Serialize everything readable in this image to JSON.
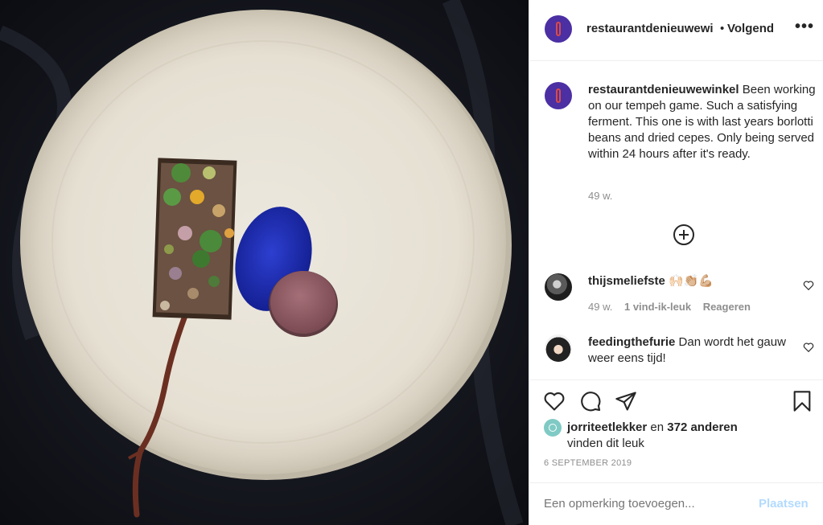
{
  "post": {
    "account": "restaurantdenieuwewi",
    "separator": "•",
    "follow_label": "Volgend",
    "more_icon": "more-dots-icon"
  },
  "caption": {
    "username": "restaurantdenieuwewinkel",
    "text": "Been working on our tempeh game. Such a satisfying ferment. This one is with last years borlotti beans and dried cepes. Only being served within 24 hours after it's ready.",
    "time": "49 w."
  },
  "load_more_icon": "plus-circle-icon",
  "comments": [
    {
      "username": "thijsmeliefste",
      "text": "🙌🏻👏🏼💪🏼",
      "time": "49 w.",
      "likes": "1 vind-ik-leuk",
      "reply": "Reageren"
    },
    {
      "username": "feedingthefurie",
      "text": "Dan wordt het gauw weer eens tijd!"
    }
  ],
  "likes": {
    "user": "jorriteetlekker",
    "middle": " en ",
    "count": "372 anderen",
    "suffix": "vinden dit leuk"
  },
  "date": "6 september 2019",
  "comment_box": {
    "placeholder": "Een opmerking toevoegen...",
    "post_label": "Plaatsen"
  },
  "colors": {
    "text": "#262626",
    "muted": "#8e8e8e",
    "post_disabled": "#b3dbff",
    "avatar": "#4b2fa3",
    "plate": "#ece7dd",
    "cloth": "#15161d",
    "blue_sauce": "#1f2fb0"
  }
}
